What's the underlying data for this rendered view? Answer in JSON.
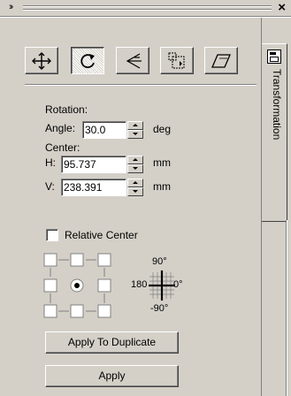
{
  "window": {
    "collapse_glyph": "››",
    "close_glyph": "×"
  },
  "tab": {
    "label": "Transformation",
    "icon": "docker-tab-icon"
  },
  "toolbar": {
    "tools": [
      {
        "name": "position",
        "icon": "move-arrows-icon"
      },
      {
        "name": "rotate",
        "icon": "rotate-icon"
      },
      {
        "name": "scale-mirror",
        "icon": "scale-mirror-icon"
      },
      {
        "name": "size",
        "icon": "size-icon"
      },
      {
        "name": "skew",
        "icon": "skew-icon"
      }
    ],
    "active": "rotate"
  },
  "rotation": {
    "section_label": "Rotation:",
    "angle_label": "Angle:",
    "angle_value": "30.0",
    "angle_unit": "deg"
  },
  "center": {
    "section_label": "Center:",
    "h_label": "H:",
    "h_value": "95.737",
    "h_unit": "mm",
    "v_label": "V:",
    "v_value": "238.391",
    "v_unit": "mm"
  },
  "relative_center": {
    "label": "Relative Center",
    "checked": false
  },
  "anchor_grid": {
    "selected": "center"
  },
  "compass": {
    "top": "90°",
    "right": "0°",
    "left": "180",
    "bottom": "-90°"
  },
  "buttons": {
    "apply_duplicate": "Apply To Duplicate",
    "apply": "Apply"
  }
}
